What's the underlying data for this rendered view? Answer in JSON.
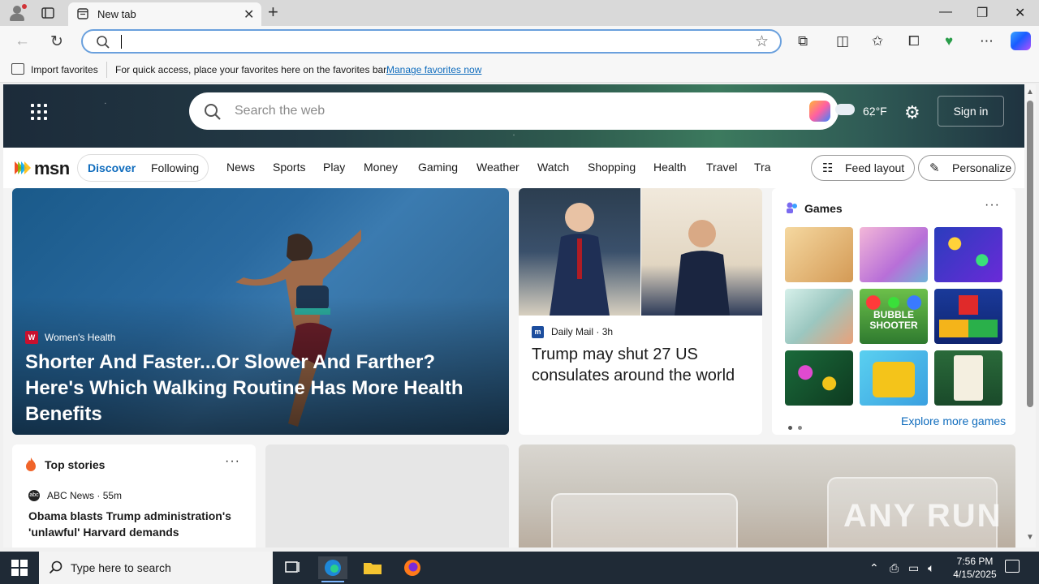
{
  "browser": {
    "tab_title": "New tab",
    "newtab_symbol": "+",
    "close_symbol": "✕",
    "min_symbol": "—",
    "restore_symbol": "❐",
    "winclose_symbol": "✕"
  },
  "address": {
    "back_symbol": "←",
    "refresh_symbol": "↻",
    "value": "",
    "star_symbol": "☆"
  },
  "toolbar": {
    "extensions_symbol": "⧉",
    "split_symbol": "◫",
    "favorites_symbol": "✩",
    "collections_symbol": "⧠",
    "performance_symbol": "♥",
    "more_symbol": "⋯"
  },
  "favbar": {
    "import_label": "Import favorites",
    "hint": "For quick access, place your favorites here on the favorites bar.",
    "manage_link": "Manage favorites now"
  },
  "msn": {
    "search_placeholder": "Search the web",
    "weather_temp": "62°F",
    "gear_symbol": "⚙",
    "signin": "Sign in",
    "logo": "msn",
    "tabs": {
      "discover": "Discover",
      "following": "Following"
    },
    "nav": [
      "News",
      "Sports",
      "Play",
      "Money",
      "Gaming",
      "Weather",
      "Watch",
      "Shopping",
      "Health",
      "Travel",
      "Tra"
    ],
    "feed_layout": "Feed layout",
    "personalize": "Personalize"
  },
  "hero_story": {
    "source_icon": "W",
    "source": "Women's Health",
    "headline": "Shorter And Faster...Or Slower And Farther? Here's Which Walking Routine Has More Health Benefits"
  },
  "news_story": {
    "source_icon": "m",
    "source": "Daily Mail",
    "age": "3h",
    "headline": "Trump may shut 27 US consulates around the world"
  },
  "games": {
    "title": "Games",
    "more_symbol": "···",
    "tiles_visible_text": {
      "bubble": "BUBBLE SHOOTER"
    },
    "explore": "Explore more games"
  },
  "top_stories": {
    "title": "Top stories",
    "more_symbol": "···",
    "source": "ABC News",
    "age": "55m",
    "headline": "Obama blasts Trump administration's 'unlawful' Harvard demands"
  },
  "watermark": "ANY RUN",
  "taskbar": {
    "search_placeholder": "Type here to search",
    "time": "7:56 PM",
    "date": "4/15/2025"
  },
  "colors": {
    "accent": "#0f6cbd",
    "taskbar": "#1f2a36"
  }
}
